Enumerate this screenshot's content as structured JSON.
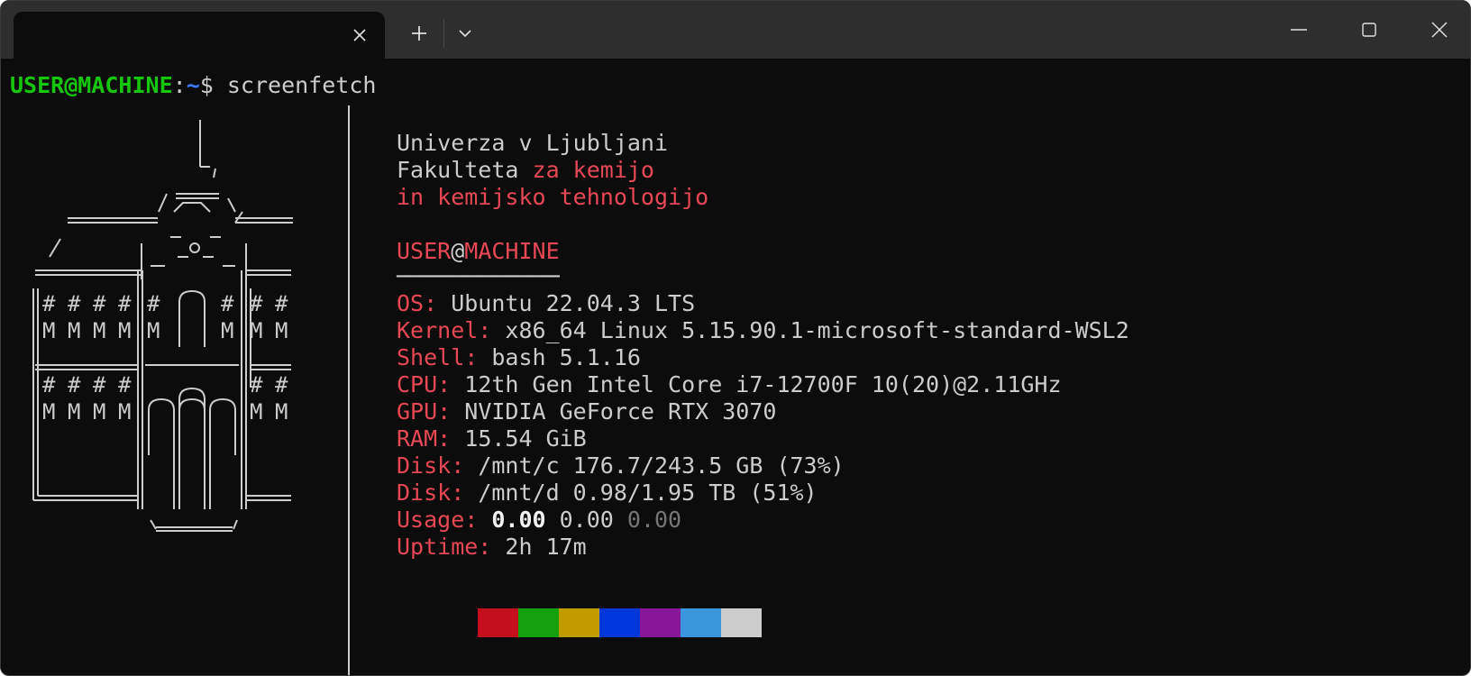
{
  "window": {
    "tab_close_icon": "close-icon",
    "new_tab_icon": "plus-icon",
    "dropdown_icon": "chevron-down-icon",
    "minimize_icon": "minimize-icon",
    "maximize_icon": "maximize-icon",
    "close_icon": "close-icon"
  },
  "prompt": {
    "user_host": "USER@MACHINE",
    "colon": ":",
    "path": "~",
    "dollar": "$",
    "command": " screenfetch"
  },
  "info": {
    "org_line1": "Univerza v Ljubljani",
    "org_line2_white": "Fakulteta ",
    "org_line2_red": "za kemijo",
    "org_line3": "in kemijsko tehnologijo",
    "user": "USER",
    "at": "@",
    "machine": "MACHINE",
    "underline": "────────────",
    "fields": [
      {
        "key": "OS:",
        "value": " Ubuntu 22.04.3 LTS"
      },
      {
        "key": "Kernel:",
        "value": " x86_64 Linux 5.15.90.1-microsoft-standard-WSL2"
      },
      {
        "key": "Shell:",
        "value": " bash 5.1.16"
      },
      {
        "key": "CPU:",
        "value": " 12th Gen Intel Core i7-12700F 10(20)@2.11GHz"
      },
      {
        "key": "GPU:",
        "value": " NVIDIA GeForce RTX 3070"
      },
      {
        "key": "RAM:",
        "value": " 15.54 GiB"
      },
      {
        "key": "Disk:",
        "value": " /mnt/c 176.7/243.5 GB (73%)"
      },
      {
        "key": "Disk:",
        "value": " /mnt/d 0.98/1.95 TB (51%)"
      }
    ],
    "usage_key": "Usage:",
    "usage_v1": " 0.00",
    "usage_v2": " 0.00",
    "usage_v3": " 0.00",
    "uptime_key": "Uptime:",
    "uptime_value": " 2h 17m"
  },
  "colors": {
    "palette": [
      "#c50f1f",
      "#13a10e",
      "#c19c00",
      "#0037da",
      "#881798",
      "#3a96dd",
      "#cccccc"
    ]
  },
  "ascii_art": [
    "       │",
    "       └┐",
    "      .══.",
    "  .═════/ .─. \\═══",
    " /    │  ─o─  │",
    "'═════│═─ ─═══│═══",
    "║# # # #║ ╭╮ ║# #",
    "║M M M M║ ╭╮ ║M M",
    "║═══════║╭╮╭╮║═══",
    "║# # # #║││││║# #",
    "║M M M M║││││║M M",
    "╚═══════╩════╩═══",
    "      `═════´"
  ]
}
